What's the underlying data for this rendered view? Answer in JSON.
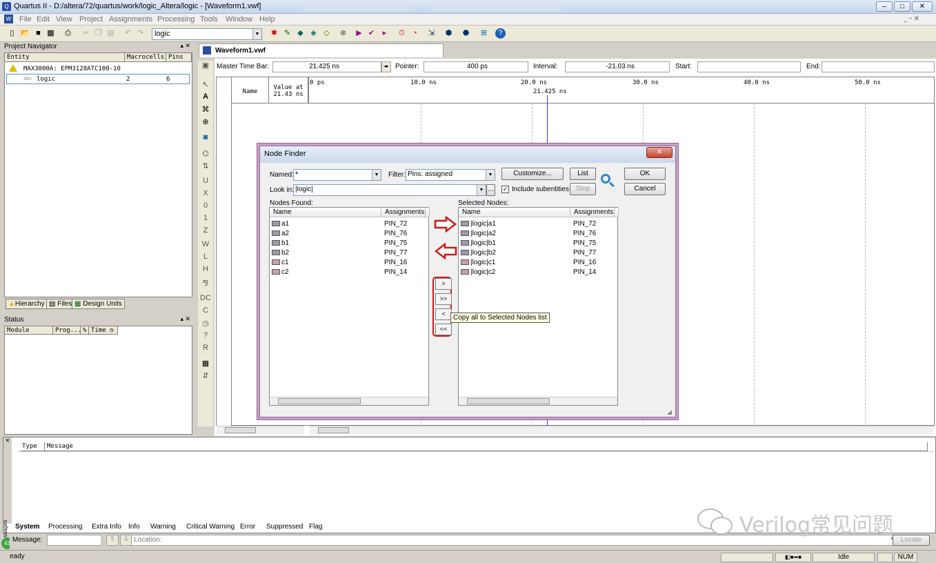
{
  "app": {
    "title": "Quartus II - D:/altera/72/quartus/work/logic_Altera/logic - [Waveform1.vwf]"
  },
  "menu": [
    "File",
    "Edit",
    "View",
    "Project",
    "Assignments",
    "Processing",
    "Tools",
    "Window",
    "Help"
  ],
  "toolbar": {
    "project_combo": "logic"
  },
  "nav": {
    "title": "Project Navigator",
    "cols": [
      "Entity",
      "Macrocells",
      "Pins"
    ],
    "device": "MAX3000A: EPM3128ATC100-10",
    "entity": "logic",
    "macrocells": "2",
    "pins": "6",
    "tabs": [
      "Hierarchy",
      "Files",
      "Design Units"
    ]
  },
  "statuspanel": {
    "title": "Status",
    "cols": [
      "Module",
      "Prog...",
      "%",
      "Time"
    ]
  },
  "wave": {
    "tab": "Waveform1.vwf",
    "master_label": "Master Time Bar:",
    "master_value": "21.425 ns",
    "pointer_label": "Pointer:",
    "pointer_value": "400 ps",
    "interval_label": "Interval:",
    "interval_value": "-21.03 ns",
    "start_label": "Start:",
    "end_label": "End:",
    "col_name": "Name",
    "col_value": "Value at",
    "col_value2": "21.43 ns",
    "cursor": "21.425 ns",
    "ticks": [
      "0 ps",
      "10.0 ns",
      "20.0 ns",
      "30.0 ns",
      "40.0 ns",
      "50.0 ns"
    ]
  },
  "dialog": {
    "title": "Node Finder",
    "named_label": "Named:",
    "named_value": "*",
    "filter_label": "Filter:",
    "filter_value": "Pins: assigned",
    "lookin_label": "Look in:",
    "lookin_value": "|logic|",
    "include_label": "Include subentities",
    "customize": "Customize...",
    "list": "List",
    "stop": "Stop",
    "ok": "OK",
    "cancel": "Cancel",
    "found_label": "Nodes Found:",
    "selected_label": "Selected Nodes:",
    "col_name": "Name",
    "col_assign": "Assignments",
    "found": [
      {
        "name": "a1",
        "pin": "PIN_72",
        "type": "input"
      },
      {
        "name": "a2",
        "pin": "PIN_76",
        "type": "input"
      },
      {
        "name": "b1",
        "pin": "PIN_75",
        "type": "input"
      },
      {
        "name": "b2",
        "pin": "PIN_77",
        "type": "input"
      },
      {
        "name": "c1",
        "pin": "PIN_16",
        "type": "output"
      },
      {
        "name": "c2",
        "pin": "PIN_14",
        "type": "output"
      }
    ],
    "selected": [
      {
        "name": "|logic|a1",
        "pin": "PIN_72",
        "type": "input"
      },
      {
        "name": "|logic|a2",
        "pin": "PIN_76",
        "type": "input"
      },
      {
        "name": "|logic|b1",
        "pin": "PIN_75",
        "type": "input"
      },
      {
        "name": "|logic|b2",
        "pin": "PIN_77",
        "type": "input"
      },
      {
        "name": "|logic|c1",
        "pin": "PIN_16",
        "type": "output"
      },
      {
        "name": "|logic|c2",
        "pin": "PIN_14",
        "type": "output"
      }
    ],
    "buttons": [
      ">",
      ">>",
      "<",
      "<<"
    ],
    "tooltip": "Copy all to Selected Nodes list"
  },
  "messages": {
    "cols": [
      "Type",
      "Message"
    ],
    "tabs": [
      "System",
      "Processing",
      "Extra Info",
      "Info",
      "Warning",
      "Critical Warning",
      "Error",
      "Suppressed",
      "Flag"
    ],
    "message_label": "Message:",
    "location_label": "Location:",
    "locate": "Locate",
    "side": "ssages",
    "badge": "43"
  },
  "statusbar": {
    "left": "eady",
    "idle": "Idle",
    "num": "NUM"
  },
  "watermark": "Verilog常见问题"
}
